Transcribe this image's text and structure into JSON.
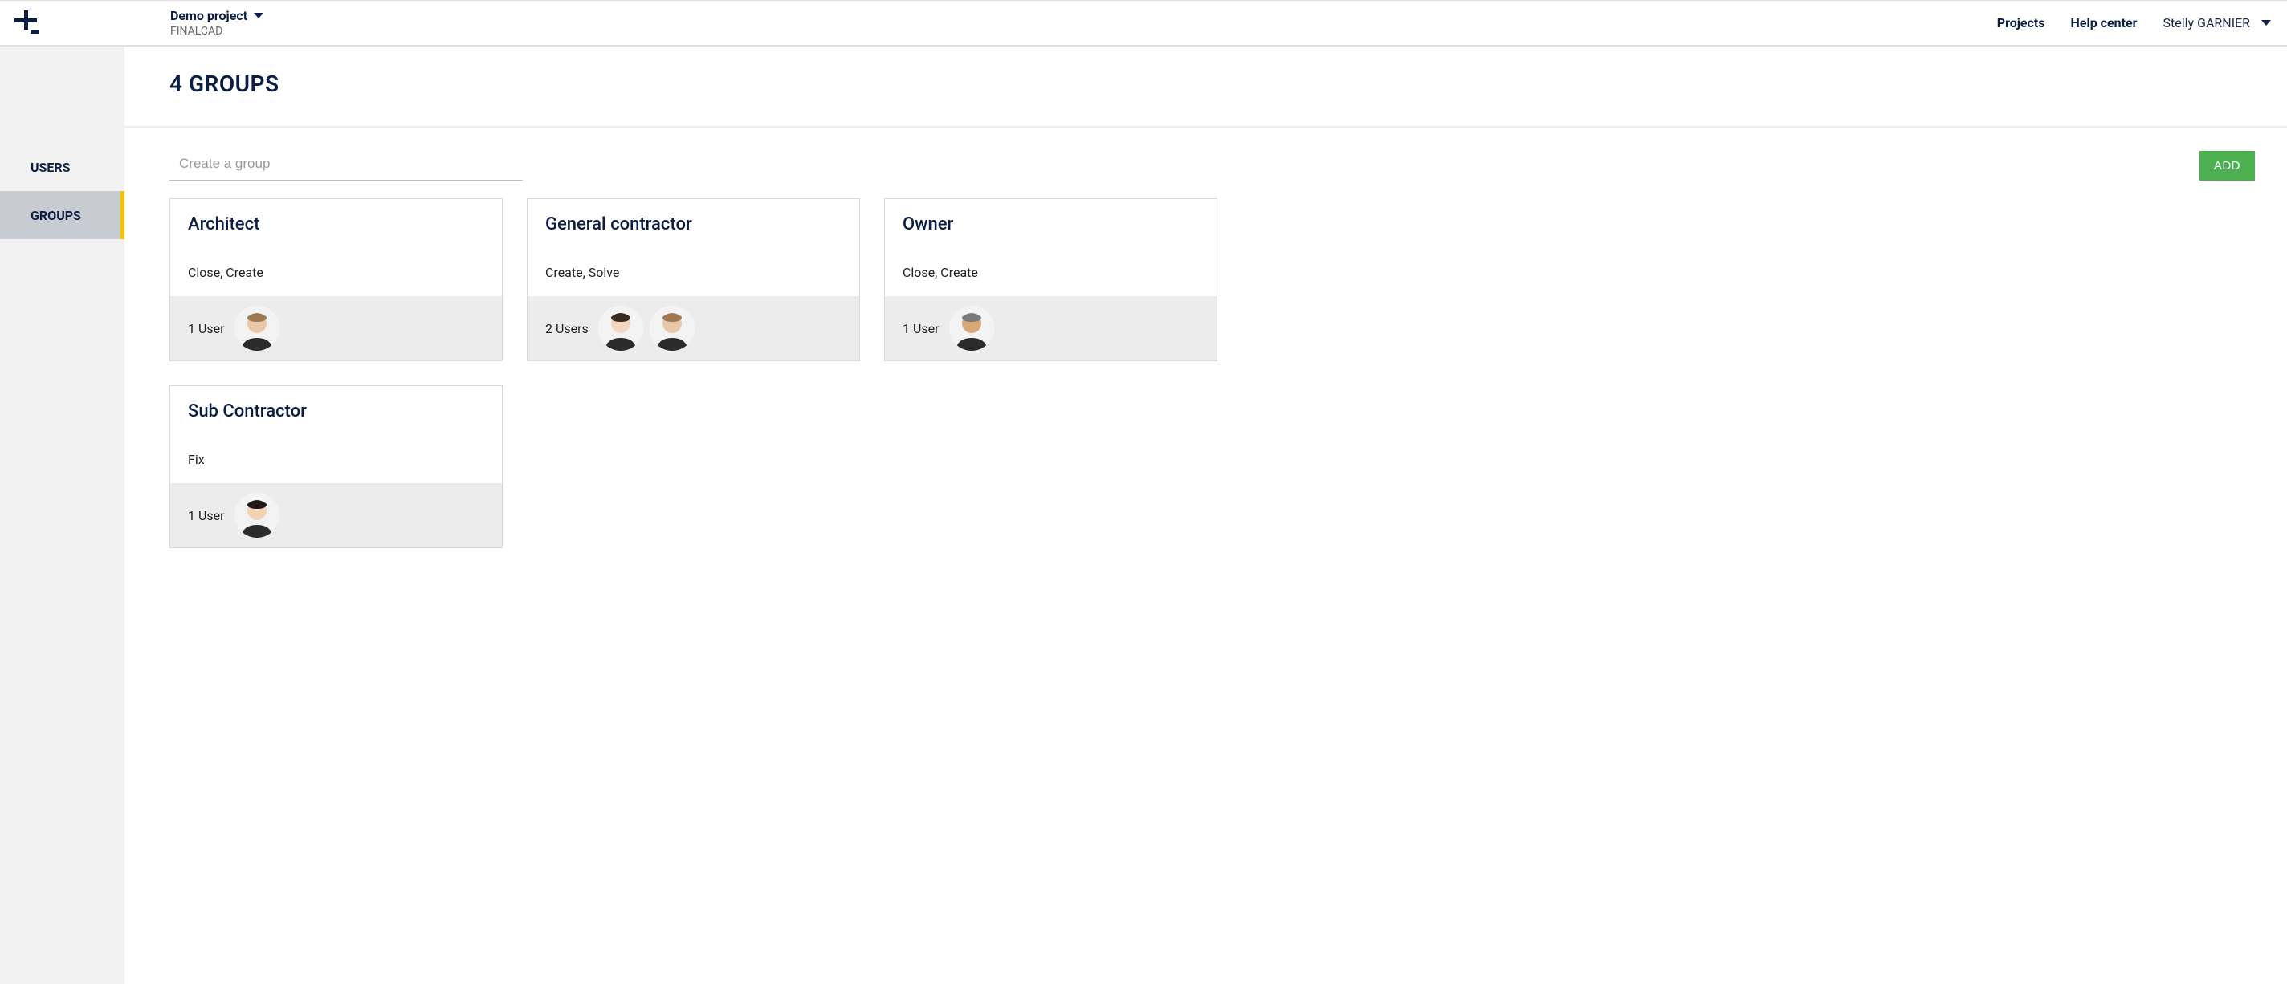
{
  "header": {
    "project_name": "Demo project",
    "org_name": "FINALCAD",
    "nav": {
      "projects": "Projects",
      "help": "Help center"
    },
    "user_name": "Stelly GARNIER"
  },
  "sidebar": {
    "users": "USERS",
    "groups": "GROUPS"
  },
  "page": {
    "title": "4 GROUPS",
    "create_placeholder": "Create a group",
    "add_label": "ADD"
  },
  "groups": [
    {
      "name": "Architect",
      "permissions": "Close, Create",
      "user_count": "1 User",
      "avatars": 1
    },
    {
      "name": "General contractor",
      "permissions": "Create, Solve",
      "user_count": "2 Users",
      "avatars": 2
    },
    {
      "name": "Owner",
      "permissions": "Close, Create",
      "user_count": "1 User",
      "avatars": 1
    },
    {
      "name": "Sub Contractor",
      "permissions": "Fix",
      "user_count": "1 User",
      "avatars": 1
    }
  ]
}
